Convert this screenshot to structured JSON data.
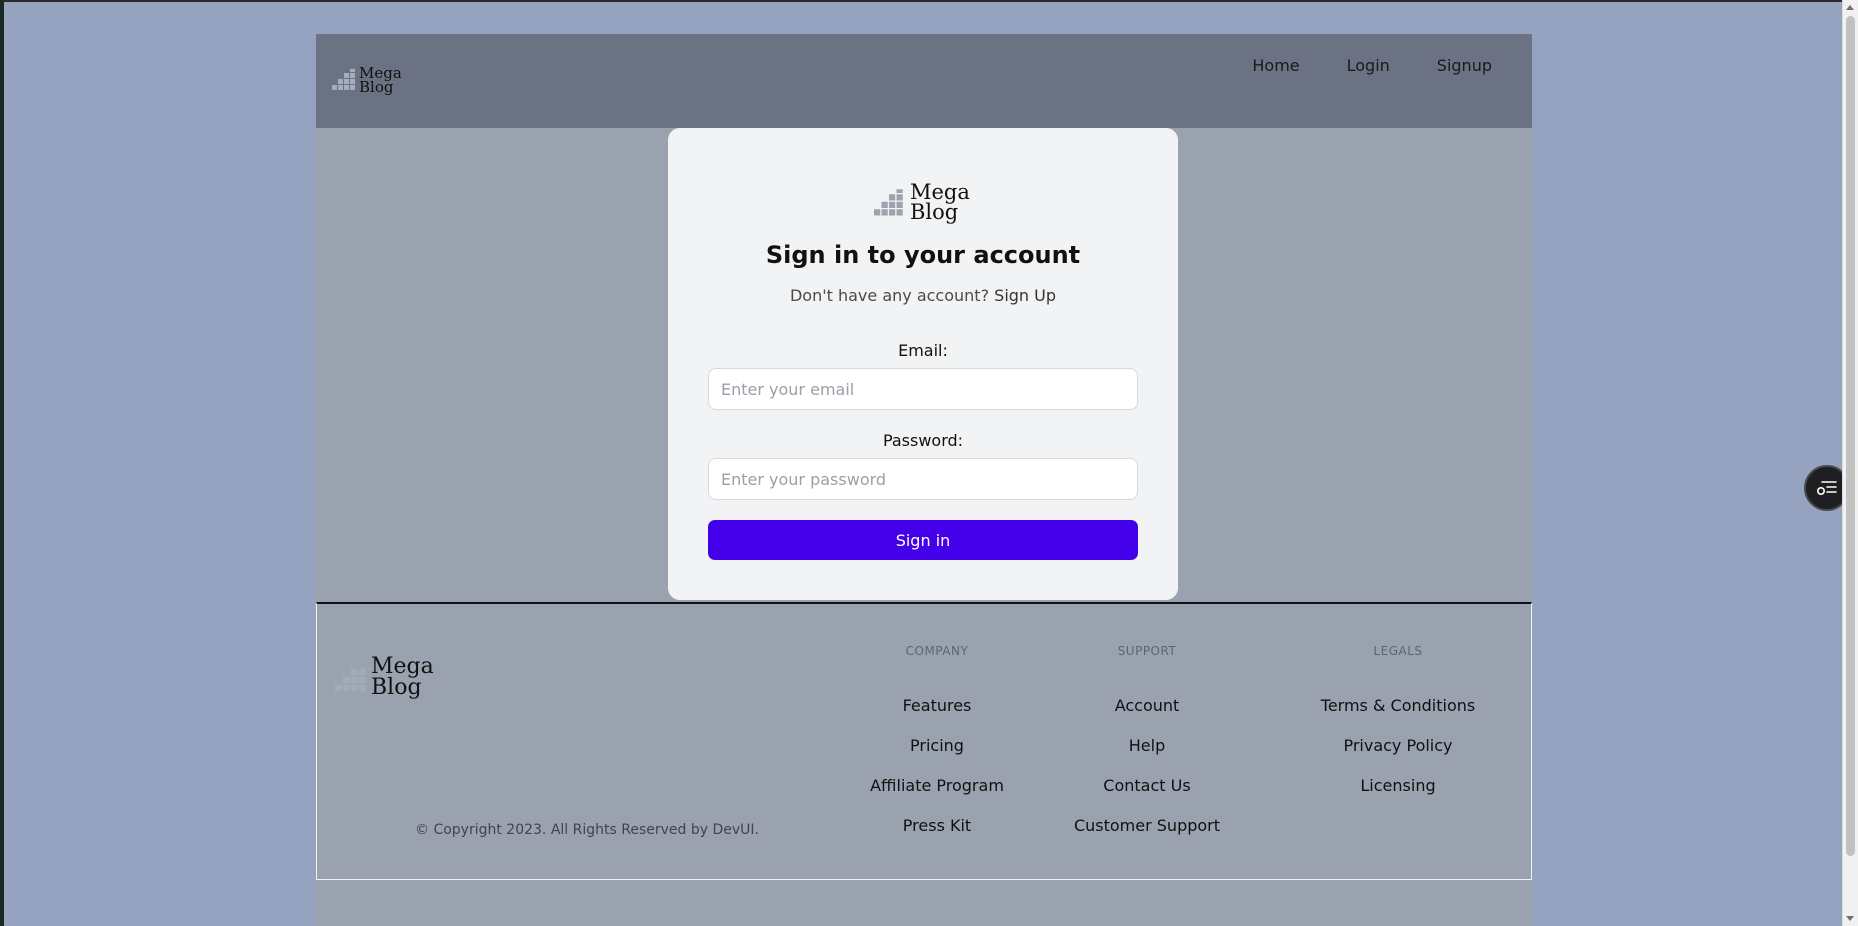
{
  "header": {
    "logo": {
      "line1": "Mega",
      "line2": "Blog",
      "icon": "stairs-logo-icon"
    },
    "nav": [
      {
        "label": "Home"
      },
      {
        "label": "Login"
      },
      {
        "label": "Signup"
      }
    ]
  },
  "login": {
    "logo": {
      "line1": "Mega",
      "line2": "Blog"
    },
    "title": "Sign in to your account",
    "subtitle": "Don't have any account?",
    "signup_link": "Sign Up",
    "email": {
      "label": "Email:",
      "placeholder": "Enter your email",
      "value": ""
    },
    "password": {
      "label": "Password:",
      "placeholder": "Enter your password",
      "value": ""
    },
    "submit_label": "Sign in",
    "accent_color": "#4400e8"
  },
  "footer": {
    "logo": {
      "line1": "Mega",
      "line2": "Blog"
    },
    "copyright": "© Copyright 2023. All Rights Reserved by DevUI.",
    "columns": [
      {
        "heading": "COMPANY",
        "links": [
          "Features",
          "Pricing",
          "Affiliate Program",
          "Press Kit"
        ]
      },
      {
        "heading": "SUPPORT",
        "links": [
          "Account",
          "Help",
          "Contact Us",
          "Customer Support"
        ]
      },
      {
        "heading": "LEGALS",
        "links": [
          "Terms & Conditions",
          "Privacy Policy",
          "Licensing"
        ]
      }
    ]
  },
  "floating_button": {
    "icon": "reader-list-icon"
  }
}
